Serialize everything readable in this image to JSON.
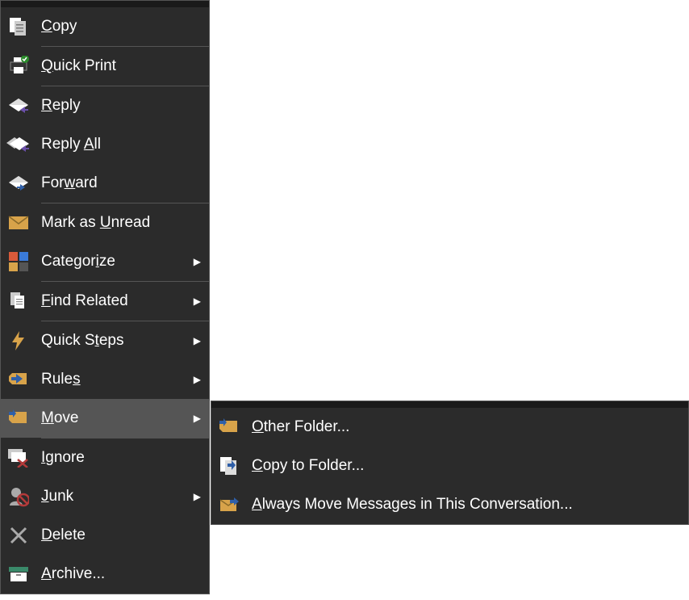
{
  "main_menu": [
    {
      "id": "copy",
      "pre": "",
      "u": "C",
      "post": "opy",
      "sub": false,
      "sep": true,
      "hover": false,
      "icon": "copy-icon"
    },
    {
      "id": "quick-print",
      "pre": "",
      "u": "Q",
      "post": "uick Print",
      "sub": false,
      "sep": true,
      "hover": false,
      "icon": "quick-print-icon"
    },
    {
      "id": "reply",
      "pre": "",
      "u": "R",
      "post": "eply",
      "sub": false,
      "sep": false,
      "hover": false,
      "icon": "reply-icon"
    },
    {
      "id": "reply-all",
      "pre": "Reply ",
      "u": "A",
      "post": "ll",
      "sub": false,
      "sep": false,
      "hover": false,
      "icon": "reply-all-icon"
    },
    {
      "id": "forward",
      "pre": "For",
      "u": "w",
      "post": "ard",
      "sub": false,
      "sep": true,
      "hover": false,
      "icon": "forward-icon"
    },
    {
      "id": "mark-unread",
      "pre": "Mark as ",
      "u": "U",
      "post": "nread",
      "sub": false,
      "sep": false,
      "hover": false,
      "icon": "mark-unread-icon"
    },
    {
      "id": "categorize",
      "pre": "Categor",
      "u": "i",
      "post": "ze",
      "sub": true,
      "sep": true,
      "hover": false,
      "icon": "categorize-icon"
    },
    {
      "id": "find-related",
      "pre": "",
      "u": "F",
      "post": "ind Related",
      "sub": true,
      "sep": true,
      "hover": false,
      "icon": "find-related-icon"
    },
    {
      "id": "quick-steps",
      "pre": "Quick S",
      "u": "t",
      "post": "eps",
      "sub": true,
      "sep": false,
      "hover": false,
      "icon": "quick-steps-icon"
    },
    {
      "id": "rules",
      "pre": "Rule",
      "u": "s",
      "post": "",
      "sub": true,
      "sep": false,
      "hover": false,
      "icon": "rules-icon"
    },
    {
      "id": "move",
      "pre": "",
      "u": "M",
      "post": "ove",
      "sub": true,
      "sep": true,
      "hover": true,
      "icon": "move-icon"
    },
    {
      "id": "ignore",
      "pre": "",
      "u": "I",
      "post": "gnore",
      "sub": false,
      "sep": false,
      "hover": false,
      "icon": "ignore-icon"
    },
    {
      "id": "junk",
      "pre": "",
      "u": "J",
      "post": "unk",
      "sub": true,
      "sep": false,
      "hover": false,
      "icon": "junk-icon"
    },
    {
      "id": "delete",
      "pre": "",
      "u": "D",
      "post": "elete",
      "sub": false,
      "sep": false,
      "hover": false,
      "icon": "delete-icon"
    },
    {
      "id": "archive",
      "pre": "",
      "u": "A",
      "post": "rchive...",
      "sub": false,
      "sep": false,
      "hover": false,
      "icon": "archive-icon"
    }
  ],
  "sub_menu": [
    {
      "id": "other-folder",
      "pre": "",
      "u": "O",
      "post": "ther Folder...",
      "icon": "other-folder-icon"
    },
    {
      "id": "copy-to-folder",
      "pre": "",
      "u": "C",
      "post": "opy to Folder...",
      "icon": "copy-to-folder-icon"
    },
    {
      "id": "always-move",
      "pre": "",
      "u": "A",
      "post": "lways Move Messages in This Conversation...",
      "icon": "always-move-icon"
    }
  ],
  "submenu_arrow": "▶"
}
